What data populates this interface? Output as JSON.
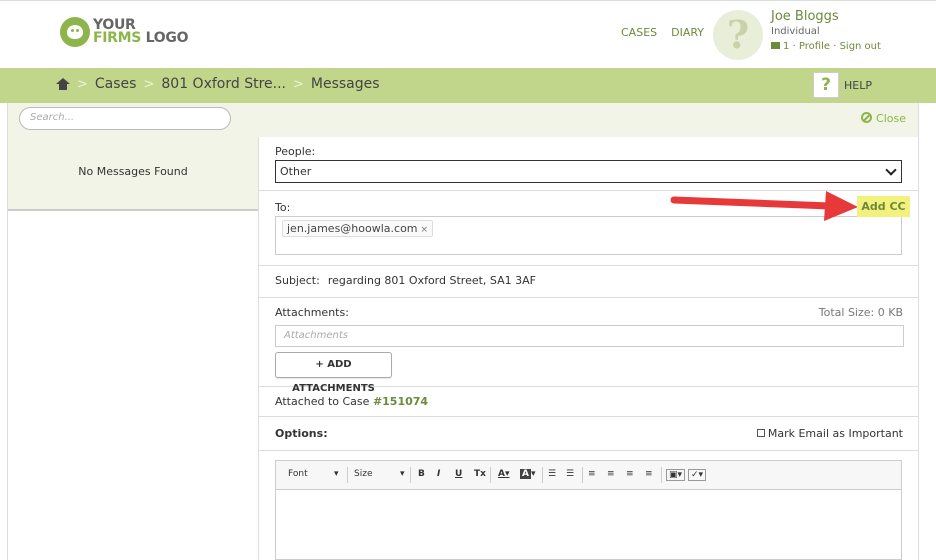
{
  "logo": {
    "line1": "YOUR",
    "line2a": "FIRMS",
    "line2b": "LOGO"
  },
  "topnav": {
    "cases": "CASES",
    "diary": "DIARY"
  },
  "user": {
    "avatar_glyph": "?",
    "name": "Joe Bloggs",
    "role": "Individual",
    "msg_count": "1",
    "profile": "· Profile ·",
    "signout": "Sign out"
  },
  "breadcrumb": {
    "cases": "Cases",
    "address": "801 Oxford Stre...",
    "current": "Messages",
    "sep": ">"
  },
  "help": {
    "glyph": "?",
    "label": "HELP"
  },
  "search": {
    "placeholder": "Search..."
  },
  "close": {
    "label": "Close"
  },
  "messages": {
    "empty_text": "No Messages Found"
  },
  "people": {
    "label": "People:",
    "selected": "Other"
  },
  "to": {
    "label": "To:",
    "recipients": [
      "jen.james@hoowla.com"
    ],
    "remove_glyph": "×"
  },
  "add_cc": {
    "label": "Add CC"
  },
  "subject": {
    "label": "Subject:",
    "value": "regarding 801 Oxford Street, SA1 3AF"
  },
  "attachments": {
    "label": "Attachments:",
    "total_size": "Total Size:  0 KB",
    "placeholder": "Attachments",
    "button": "+ ADD ATTACHMENTS"
  },
  "case": {
    "label": "Attached to Case",
    "number": "#151074"
  },
  "options": {
    "label": "Options:",
    "important": "Mark Email as Important"
  },
  "editor": {
    "font": "Font",
    "size": "Size",
    "bold": "B",
    "italic": "I",
    "underline": "U",
    "clear": "Tx"
  },
  "colors": {
    "brand_green": "#8db54b",
    "bar_green": "#c1d68b",
    "highlight": "#f3f17d",
    "arrow_red": "#e8393a"
  }
}
